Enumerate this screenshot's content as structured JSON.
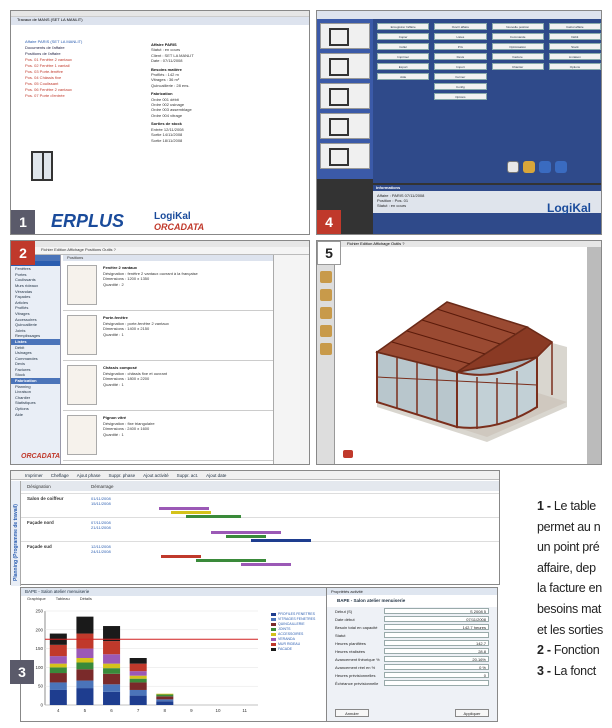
{
  "panels": {
    "p1": {
      "number": "1",
      "tab_label": "Travaux de MANS (SET LA MANLIT)",
      "tree": [
        {
          "text": "Affaire PARIS (SET LA MANLIT)",
          "style": "blue"
        },
        {
          "text": "Documents de l'affaire",
          "style": ""
        },
        {
          "text": "Positions de l'affaire",
          "style": ""
        },
        {
          "text": "Pos. 01 Fenêtre 2 vantaux",
          "style": "red"
        },
        {
          "text": "Pos. 02 Fenêtre 1 vantail",
          "style": "red"
        },
        {
          "text": "Pos. 03 Porte-fenêtre",
          "style": "red"
        },
        {
          "text": "Pos. 04 Châssis fixe",
          "style": "red"
        },
        {
          "text": "Pos. 05 Coulissant",
          "style": "red"
        },
        {
          "text": "Pos. 06 Fenêtre 2 vantaux",
          "style": "red"
        },
        {
          "text": "Pos. 07 Porte d'entrée",
          "style": "red"
        }
      ],
      "detail": [
        {
          "h": "Affaire PARIS",
          "rows": [
            "Statut : en cours",
            "Client : SET LA MANLIT",
            "Date : 07/11/2008"
          ]
        },
        {
          "h": "Besoins matière",
          "rows": [
            "Profilés  :  142 m",
            "Vitrages  :  36 m²",
            "Quincaillerie : 28 ens."
          ]
        },
        {
          "h": "Fabrication",
          "rows": [
            "Ordre 001  débit",
            "Ordre 002  usinage",
            "Ordre 003  assemblage",
            "Ordre 004  vitrage"
          ]
        },
        {
          "h": "Sorties de stock",
          "rows": [
            "Entrée 12/11/2008",
            "Sortie 14/11/2008",
            "Sortie 18/11/2008"
          ]
        }
      ],
      "logo_erp": "ERPLUS",
      "logo_logikal": "LogiKal",
      "logo_orcadata": "ORCADATA"
    },
    "p4": {
      "number": "4",
      "buttons": [
        "Enregistrer l'affaire",
        "Ouvrir affaire",
        "Nouvelle position",
        "Calcul affaire",
        "Copier",
        "Listes",
        "Commande",
        "Débit",
        "Coller",
        "Prix",
        "Optimisation",
        "Stock",
        "Imprimer",
        "Devis",
        "Facture",
        "Livraison",
        "Export",
        "Import",
        "Chantier",
        "Options",
        "Aide",
        "Fermer",
        "",
        "",
        "",
        "Config",
        "",
        "",
        "",
        "Options",
        "",
        ""
      ],
      "info_title": "Informations",
      "info_rows": [
        "Affaire : PARIS 07/11/2008",
        "Position : Pos. 01",
        "Statut : en cours"
      ],
      "logo": "LogiKal"
    },
    "p2": {
      "number": "2",
      "toolbar_label": "Fichier  Edition  Affichage  Positions  Outils  ?",
      "list_header": "Positions",
      "sidebar": [
        {
          "t": "Affaire",
          "c": "grp"
        },
        {
          "t": "Positions",
          "c": "sel"
        },
        {
          "t": "Fenêtres",
          "c": ""
        },
        {
          "t": "Portes",
          "c": ""
        },
        {
          "t": "Coulissants",
          "c": ""
        },
        {
          "t": "Murs rideaux",
          "c": ""
        },
        {
          "t": "Vérandas",
          "c": ""
        },
        {
          "t": "Façades",
          "c": ""
        },
        {
          "t": "Articles",
          "c": ""
        },
        {
          "t": "Profilés",
          "c": ""
        },
        {
          "t": "Vitrages",
          "c": ""
        },
        {
          "t": "Accessoires",
          "c": ""
        },
        {
          "t": "Quincaillerie",
          "c": ""
        },
        {
          "t": "Joints",
          "c": ""
        },
        {
          "t": "Remplissages",
          "c": ""
        },
        {
          "t": "Listes",
          "c": "grp"
        },
        {
          "t": "Débit",
          "c": ""
        },
        {
          "t": "Usinages",
          "c": ""
        },
        {
          "t": "Commandes",
          "c": ""
        },
        {
          "t": "Devis",
          "c": ""
        },
        {
          "t": "Factures",
          "c": ""
        },
        {
          "t": "Stock",
          "c": ""
        },
        {
          "t": "Fabrication",
          "c": "grp"
        },
        {
          "t": "Planning",
          "c": ""
        },
        {
          "t": "Livraison",
          "c": ""
        },
        {
          "t": "Chantier",
          "c": ""
        },
        {
          "t": "Statistiques",
          "c": ""
        },
        {
          "t": "Options",
          "c": ""
        },
        {
          "t": "Aide",
          "c": ""
        }
      ],
      "items": [
        {
          "title": "Fenêtre 2 vantaux",
          "lines": [
            "Désignation : fenêtre 2 vantaux ouvrant à la française",
            "Dimensions : 1200 x 1350",
            "Quantité : 2"
          ]
        },
        {
          "title": "Porte-fenêtre",
          "lines": [
            "Désignation : porte-fenêtre 2 vantaux",
            "Dimensions : 1400 x 2150",
            "Quantité : 1"
          ]
        },
        {
          "title": "Châssis composé",
          "lines": [
            "Désignation : châssis fixe et ouvrant",
            "Dimensions : 1800 x 2200",
            "Quantité : 1"
          ]
        },
        {
          "title": "Pignon vitré",
          "lines": [
            "Désignation : fixe triangulaire",
            "Dimensions : 2400 x 1600",
            "Quantité : 1"
          ]
        }
      ],
      "logo": "ORCADATA"
    },
    "p5": {
      "number": "5",
      "menu": "Fichier  Edition  Affichage  Outils  ?"
    },
    "p3": {
      "number": "3",
      "toolbar": [
        "Imprimer",
        "Cheflage",
        "Ajout phase",
        "Suppr. phase",
        "Ajout activité",
        "Suppr. act.",
        "Ajout date"
      ],
      "head_cols": [
        "Désignation",
        "Démarrage"
      ],
      "side_label": "Planning (Programme de travail)",
      "rows": [
        {
          "label": "Salon de coiffeur",
          "dates": [
            "01/11/2008",
            "15/11/2008"
          ]
        },
        {
          "label": "Façade nord",
          "dates": [
            "07/11/2008",
            "21/11/2008"
          ]
        },
        {
          "label": "Façade sud",
          "dates": [
            "12/11/2008",
            "24/11/2008"
          ]
        }
      ],
      "chart_title": "BAPE - Salon atelier menuiserie",
      "chart_tabs": [
        "Graphique",
        "Tableau",
        "Détails"
      ],
      "legend": [
        {
          "t": "PROFILES FENETRES",
          "c": "#1e3d8f"
        },
        {
          "t": "VITRAGES FENETRES",
          "c": "#4b74b9"
        },
        {
          "t": "QUINCAILLERIE",
          "c": "#7a2a2a"
        },
        {
          "t": "JOINTS",
          "c": "#3a8a3a"
        },
        {
          "t": "ACCESSOIRES",
          "c": "#d4c21a"
        },
        {
          "t": "VERANDA",
          "c": "#9b59b6"
        },
        {
          "t": "MUR RIDEAU",
          "c": "#c0392b"
        },
        {
          "t": "FACADE",
          "c": "#1a1a1a"
        }
      ],
      "prop_title": "Propriétés activité",
      "prop_header": "BAPE - Salon atelier menuiserie",
      "prop_rows": [
        {
          "k": "Début (S)",
          "v": "S 2008 5"
        },
        {
          "k": "Date début",
          "v": "07/11/2008"
        },
        {
          "k": "Besoin total en capacité",
          "v": "142.7 heures"
        },
        {
          "k": "Statut",
          "v": ""
        },
        {
          "k": "Heures planifiées",
          "v": "142.7"
        },
        {
          "k": "Heures réalisées",
          "v": "28.8"
        },
        {
          "k": "Avancement théorique %",
          "v": "20.16%"
        },
        {
          "k": "Avancement réel en %",
          "v": "0 %"
        },
        {
          "k": "Heures prévisionnelles",
          "v": "0"
        },
        {
          "k": "Échéance prévisionnelle",
          "v": ""
        }
      ],
      "prop_buttons": [
        "Annuler",
        "Appliquer"
      ]
    }
  },
  "chart_data": {
    "type": "bar",
    "title": "BAPE - Salon atelier menuiserie",
    "xlabel": "",
    "ylabel": "",
    "categories": [
      "4",
      "5",
      "6",
      "7",
      "8",
      "9",
      "10",
      "11"
    ],
    "ylim": [
      0,
      250
    ],
    "series": [
      {
        "name": "PROFILES FENETRES",
        "values": [
          40,
          45,
          35,
          25,
          10,
          0,
          0,
          0
        ]
      },
      {
        "name": "VITRAGES FENETRES",
        "values": [
          20,
          20,
          20,
          15,
          5,
          0,
          0,
          0
        ]
      },
      {
        "name": "QUINCAILLERIE",
        "values": [
          25,
          30,
          28,
          20,
          8,
          0,
          0,
          0
        ]
      },
      {
        "name": "JOINTS",
        "values": [
          15,
          18,
          15,
          10,
          5,
          0,
          0,
          0
        ]
      },
      {
        "name": "ACCESSOIRES",
        "values": [
          10,
          12,
          12,
          8,
          2,
          0,
          0,
          0
        ]
      },
      {
        "name": "VERANDA",
        "values": [
          20,
          25,
          25,
          12,
          0,
          0,
          0,
          0
        ]
      },
      {
        "name": "MUR RIDEAU",
        "values": [
          30,
          40,
          35,
          20,
          0,
          0,
          0,
          0
        ]
      },
      {
        "name": "FACADE",
        "values": [
          30,
          45,
          40,
          15,
          0,
          0,
          0,
          0
        ]
      }
    ],
    "capacity_line": 175,
    "yticks": [
      "0",
      "50",
      "100",
      "150",
      "200",
      "250"
    ]
  },
  "caption": [
    {
      "num": "1 -",
      "text": "Le table"
    },
    {
      "num": "",
      "text": "permet au n"
    },
    {
      "num": "",
      "text": "un point pré"
    },
    {
      "num": "",
      "text": "affaire, dep"
    },
    {
      "num": "",
      "text": "la facture en"
    },
    {
      "num": "",
      "text": "besoins mat"
    },
    {
      "num": "",
      "text": "et les sorties"
    },
    {
      "num": "2 -",
      "text": "Fonction"
    },
    {
      "num": "3 -",
      "text": "La fonct"
    }
  ]
}
